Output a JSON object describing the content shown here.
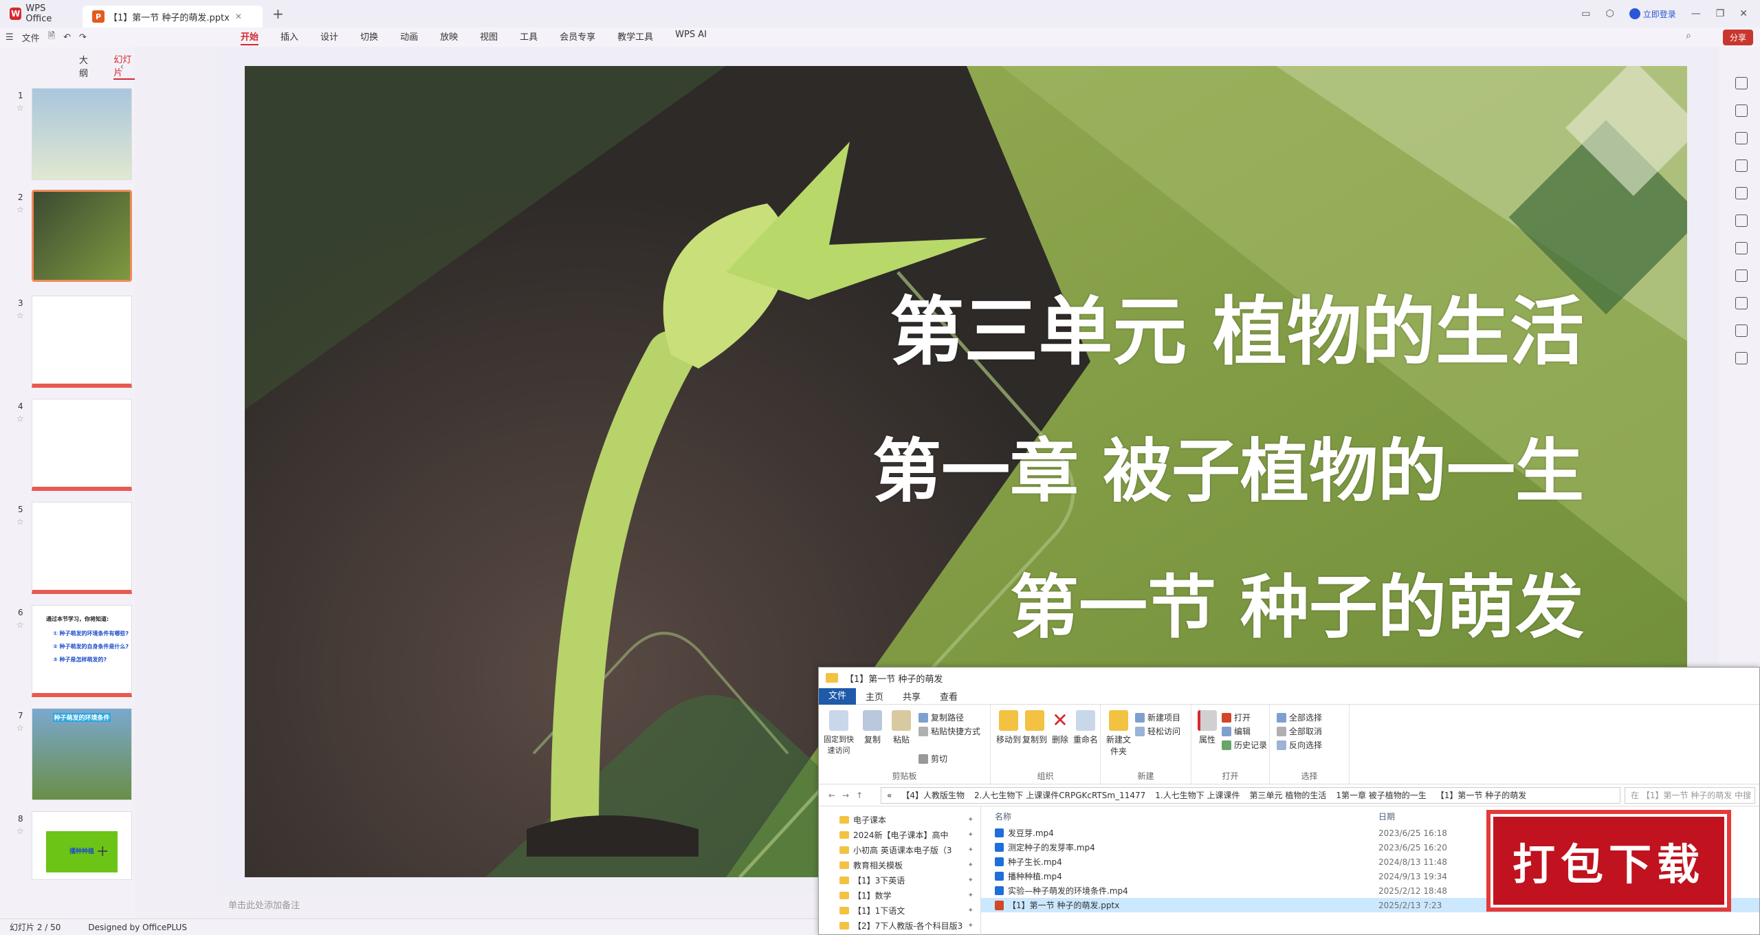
{
  "titlebar": {
    "app_tab": "WPS Office",
    "doc_tab": "【1】第一节 种子的萌发.pptx",
    "login": "立即登录"
  },
  "menubar": {
    "file": "文件",
    "items": [
      "开始",
      "插入",
      "设计",
      "切换",
      "动画",
      "放映",
      "视图",
      "工具",
      "会员专享",
      "教学工具",
      "WPS AI"
    ],
    "share": "分享"
  },
  "leftpanel": {
    "tab_outline": "大纲",
    "tab_slides": "幻灯片",
    "slide_numbers": [
      "1",
      "2",
      "3",
      "4",
      "5",
      "6",
      "7",
      "8"
    ],
    "slide6_lines": [
      "通过本节学习，你将知道:",
      "① 种子萌发的环境条件有哪些?",
      "② 种子萌发的自身条件是什么?",
      "③ 种子是怎样萌发的?"
    ],
    "slide7_title": "种子萌发的环境条件",
    "slide8_label": "播种种植"
  },
  "slide": {
    "title1": "第三单元 植物的生活",
    "title2": "第一章 被子植物的一生",
    "title3": "第一节 种子的萌发"
  },
  "notes_placeholder": "单击此处添加备注",
  "statusbar": {
    "slide_count": "幻灯片 2 / 50",
    "designer": "Designed by OfficePLUS"
  },
  "explorer": {
    "title": "【1】第一节 种子的萌发",
    "tabs": [
      "文件",
      "主页",
      "共享",
      "查看"
    ],
    "ribbon": {
      "pin": "固定到快速访问",
      "copy": "复制",
      "paste": "粘贴",
      "copy_path": "复制路径",
      "paste_shortcut": "粘贴快捷方式",
      "cut": "剪切",
      "clipboard": "剪贴板",
      "move_to": "移动到",
      "copy_to": "复制到",
      "delete": "删除",
      "rename": "重命名",
      "organize": "组织",
      "new_folder": "新建文件夹",
      "new_item": "新建项目",
      "easy_access": "轻松访问",
      "new": "新建",
      "properties": "属性",
      "open": "打开",
      "edit": "编辑",
      "history": "历史记录",
      "open_group": "打开",
      "select_all": "全部选择",
      "select_none": "全部取消",
      "invert": "反向选择",
      "select_group": "选择"
    },
    "breadcrumbs": [
      "«",
      "【4】人教版生物",
      "2.人七生物下 上课课件CRPGKcRTSm_11477",
      "1.人七生物下 上课课件",
      "第三单元 植物的生活",
      "1第一章 被子植物的一生",
      "【1】第一节 种子的萌发"
    ],
    "search_placeholder": "在 【1】第一节 种子的萌发 中搜",
    "nav_items": [
      "电子课本",
      "2024新【电子课本】高中",
      "小初高 英语课本电子版（3",
      "教育相关模板",
      "【1】3下英语",
      "【1】数学",
      "【1】1下语文",
      "【2】7下人教版-各个科目版3"
    ],
    "col_name": "名称",
    "col_date": "日期",
    "files": [
      {
        "name": "发豆芽.mp4",
        "date": "2023/6/25 16:18"
      },
      {
        "name": "测定种子的发芽率.mp4",
        "date": "2023/6/25 16:20"
      },
      {
        "name": "种子生长.mp4",
        "date": "2024/8/13 11:48"
      },
      {
        "name": "播种种植.mp4",
        "date": "2024/9/13 19:34"
      },
      {
        "name": "实验—种子萌发的环境条件.mp4",
        "date": "2025/2/12 18:48"
      },
      {
        "name": "【1】第一节 种子的萌发.pptx",
        "date": "2025/2/13 7:23"
      }
    ]
  },
  "stamp": "打包下载",
  "colors": {
    "accent": "#d7282f",
    "slide_green": "#7f9a3f",
    "dark_green": "#3f6b3a"
  }
}
